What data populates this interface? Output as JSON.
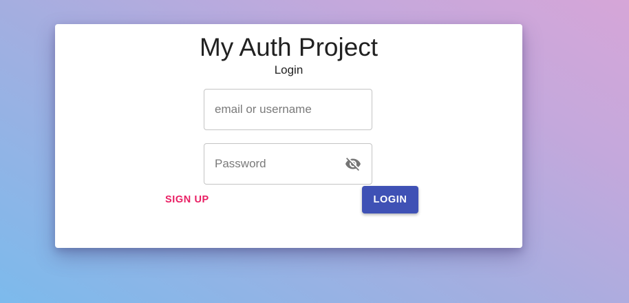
{
  "app": {
    "title": "My Auth Project",
    "subtitle": "Login"
  },
  "form": {
    "email": {
      "placeholder": "email or username",
      "value": ""
    },
    "password": {
      "placeholder": "Password",
      "value": "",
      "toggle_icon": "eye-off-icon"
    }
  },
  "actions": {
    "signup_label": "SIGN UP",
    "login_label": "LOGIN"
  },
  "colors": {
    "primary": "#3f51b5",
    "secondary": "#e91e63",
    "background_start": "#7cbaec",
    "background_end": "#d6a6d8"
  }
}
